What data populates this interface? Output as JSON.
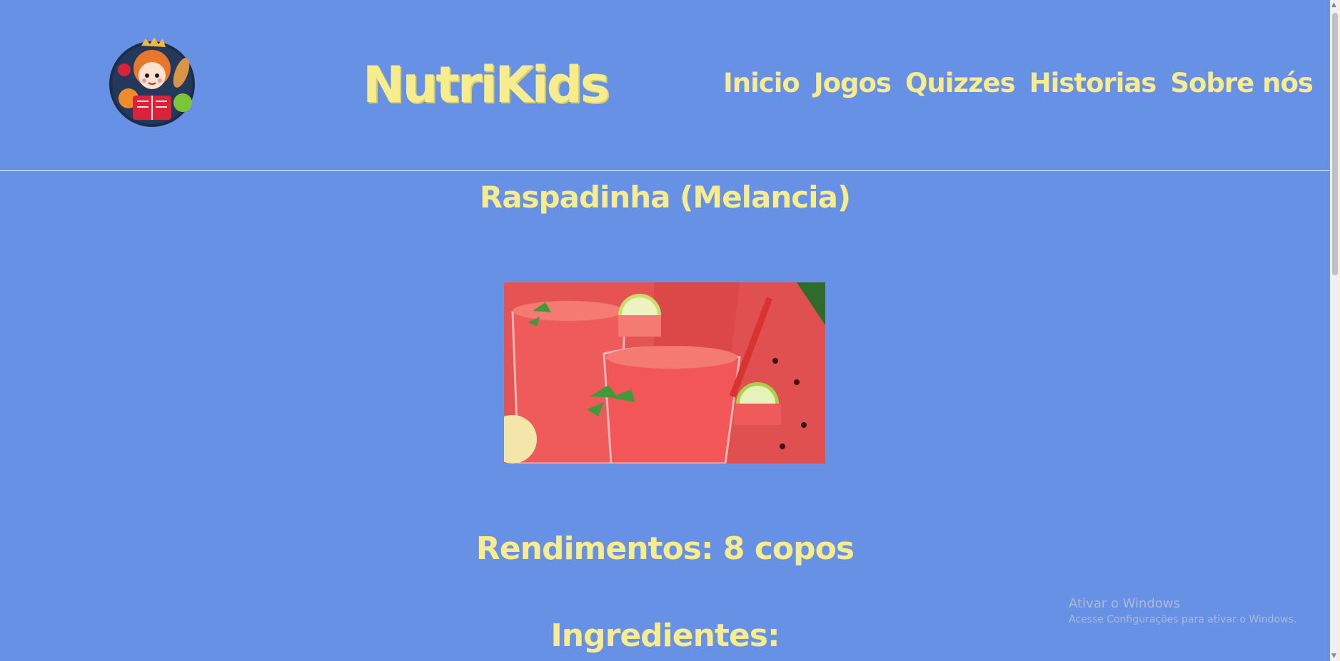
{
  "header": {
    "brand": "NutriKids",
    "nav": [
      {
        "label": "Inicio"
      },
      {
        "label": "Jogos"
      },
      {
        "label": "Quizzes"
      },
      {
        "label": "Historias"
      },
      {
        "label": "Sobre nós"
      }
    ]
  },
  "recipe": {
    "title": "Raspadinha (Melancia)",
    "yield": "Rendimentos: 8 copos",
    "ingredients_heading": "Ingredientes:"
  },
  "watermark": {
    "line1": "Ativar o Windows",
    "line2": "Acesse Configurações para ativar o Windows."
  },
  "colors": {
    "background": "#6791e4",
    "text_yellow": "#f7ec8e",
    "divider": "#e8eef8"
  },
  "icons": {
    "logo": "chef-girl-reading-book-logo",
    "scroll_up": "chevron-up-icon",
    "scroll_down": "chevron-down-icon"
  }
}
